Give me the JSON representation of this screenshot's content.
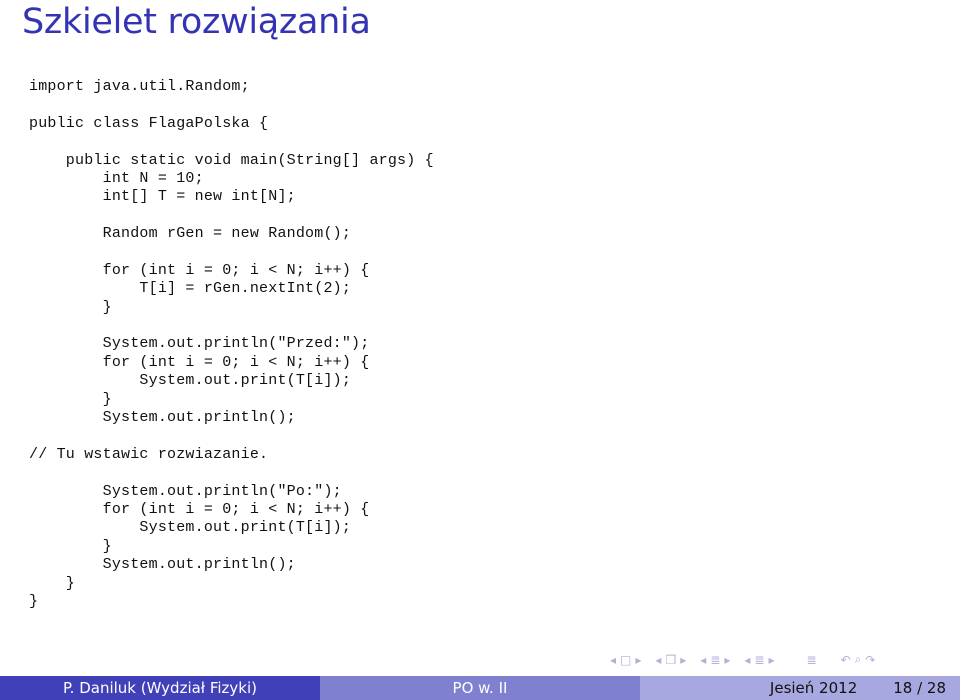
{
  "slide": {
    "title": "Szkielet rozwiązania",
    "code_lines": [
      "import java.util.Random;",
      "",
      "public class FlagaPolska {",
      "",
      "    public static void main(String[] args) {",
      "        int N = 10;",
      "        int[] T = new int[N];",
      "",
      "        Random rGen = new Random();",
      "",
      "        for (int i = 0; i < N; i++) {",
      "            T[i] = rGen.nextInt(2);",
      "        }",
      "",
      "        System.out.println(\"Przed:\");",
      "        for (int i = 0; i < N; i++) {",
      "            System.out.print(T[i]);",
      "        }",
      "        System.out.println();",
      "",
      "// Tu wstawic rozwiazanie.",
      "",
      "        System.out.println(\"Po:\");",
      "        for (int i = 0; i < N; i++) {",
      "            System.out.print(T[i]);",
      "        }",
      "        System.out.println();",
      "    }",
      "}"
    ]
  },
  "navigation": {
    "icons": [
      "nav-prev-arrow",
      "frame-icon",
      "nav-next-arrow",
      "nav-prev-arrow",
      "subsection-icon",
      "nav-next-arrow",
      "nav-prev-arrow",
      "section-icon",
      "nav-next-arrow",
      "nav-prev-arrow",
      "document-icon",
      "nav-next-arrow",
      "outline-icon",
      "undo-icon",
      "search-icon",
      "redo-icon"
    ]
  },
  "footer": {
    "author": "P. Daniluk  (Wydział Fizyki)",
    "course": "PO w. II",
    "date": "Jesień 2012",
    "page": "18 / 28"
  },
  "colors": {
    "title": "#3333b3",
    "footer_dark": "#4040b8",
    "footer_mid": "#8080d0",
    "footer_light": "#a8a8e0"
  }
}
